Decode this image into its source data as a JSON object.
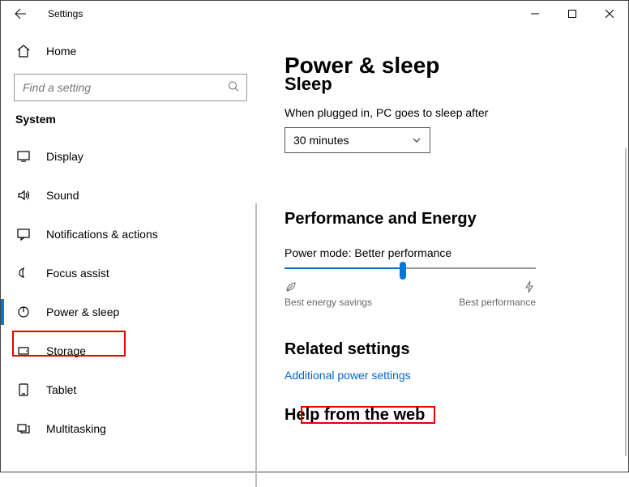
{
  "titlebar": {
    "title": "Settings"
  },
  "sidebar": {
    "home": "Home",
    "search_placeholder": "Find a setting",
    "section": "System",
    "items": [
      {
        "label": "Display"
      },
      {
        "label": "Sound"
      },
      {
        "label": "Notifications & actions"
      },
      {
        "label": "Focus assist"
      },
      {
        "label": "Power & sleep"
      },
      {
        "label": "Storage"
      },
      {
        "label": "Tablet"
      },
      {
        "label": "Multitasking"
      }
    ]
  },
  "main": {
    "page_title": "Power & sleep",
    "sleep_heading": "Sleep",
    "sleep_text": "When plugged in, PC goes to sleep after",
    "sleep_value": "30 minutes",
    "perf_heading": "Performance and Energy",
    "power_mode_label": "Power mode: Better performance",
    "slider_left": "Best energy savings",
    "slider_right": "Best performance",
    "related_heading": "Related settings",
    "related_link": "Additional power settings",
    "help_heading": "Help from the web"
  }
}
